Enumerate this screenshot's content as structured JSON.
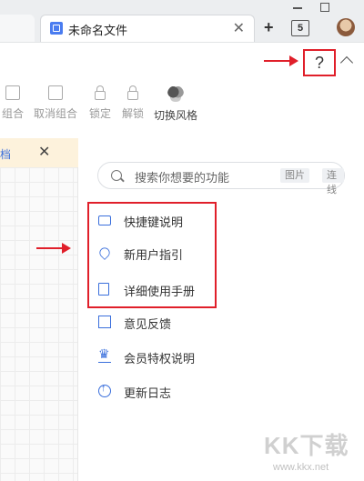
{
  "tabs": {
    "doc_title": "未命名文件",
    "tab_count": "5",
    "close_glyph": "✕",
    "new_tab_glyph": "+"
  },
  "toolbar": {
    "help_glyph": "?",
    "buttons": [
      {
        "label": "组合",
        "icon": "group-icon"
      },
      {
        "label": "取消组合",
        "icon": "ungroup-icon"
      },
      {
        "label": "锁定",
        "icon": "lock-icon"
      },
      {
        "label": "解锁",
        "icon": "unlock-icon"
      },
      {
        "label": "切换风格",
        "icon": "style-icon"
      }
    ]
  },
  "canvas": {
    "bar_text": "档",
    "close_glyph": "✕"
  },
  "help_panel": {
    "search": {
      "placeholder": "搜索你想要的功能",
      "chips": [
        "图片",
        "连线"
      ]
    },
    "items": [
      {
        "label": "快捷键说明",
        "icon": "keyboard-icon"
      },
      {
        "label": "新用户指引",
        "icon": "guide-icon"
      },
      {
        "label": "详细使用手册",
        "icon": "manual-icon"
      },
      {
        "label": "意见反馈",
        "icon": "feedback-icon"
      },
      {
        "label": "会员特权说明",
        "icon": "crown-icon"
      },
      {
        "label": "更新日志",
        "icon": "update-icon"
      }
    ]
  },
  "watermark": {
    "logo": "KK下载",
    "url": "www.kkx.net"
  },
  "colors": {
    "accent": "#3a6fdc",
    "annotation_red": "#e01f2a",
    "bar_bg": "#fdf2dc"
  }
}
